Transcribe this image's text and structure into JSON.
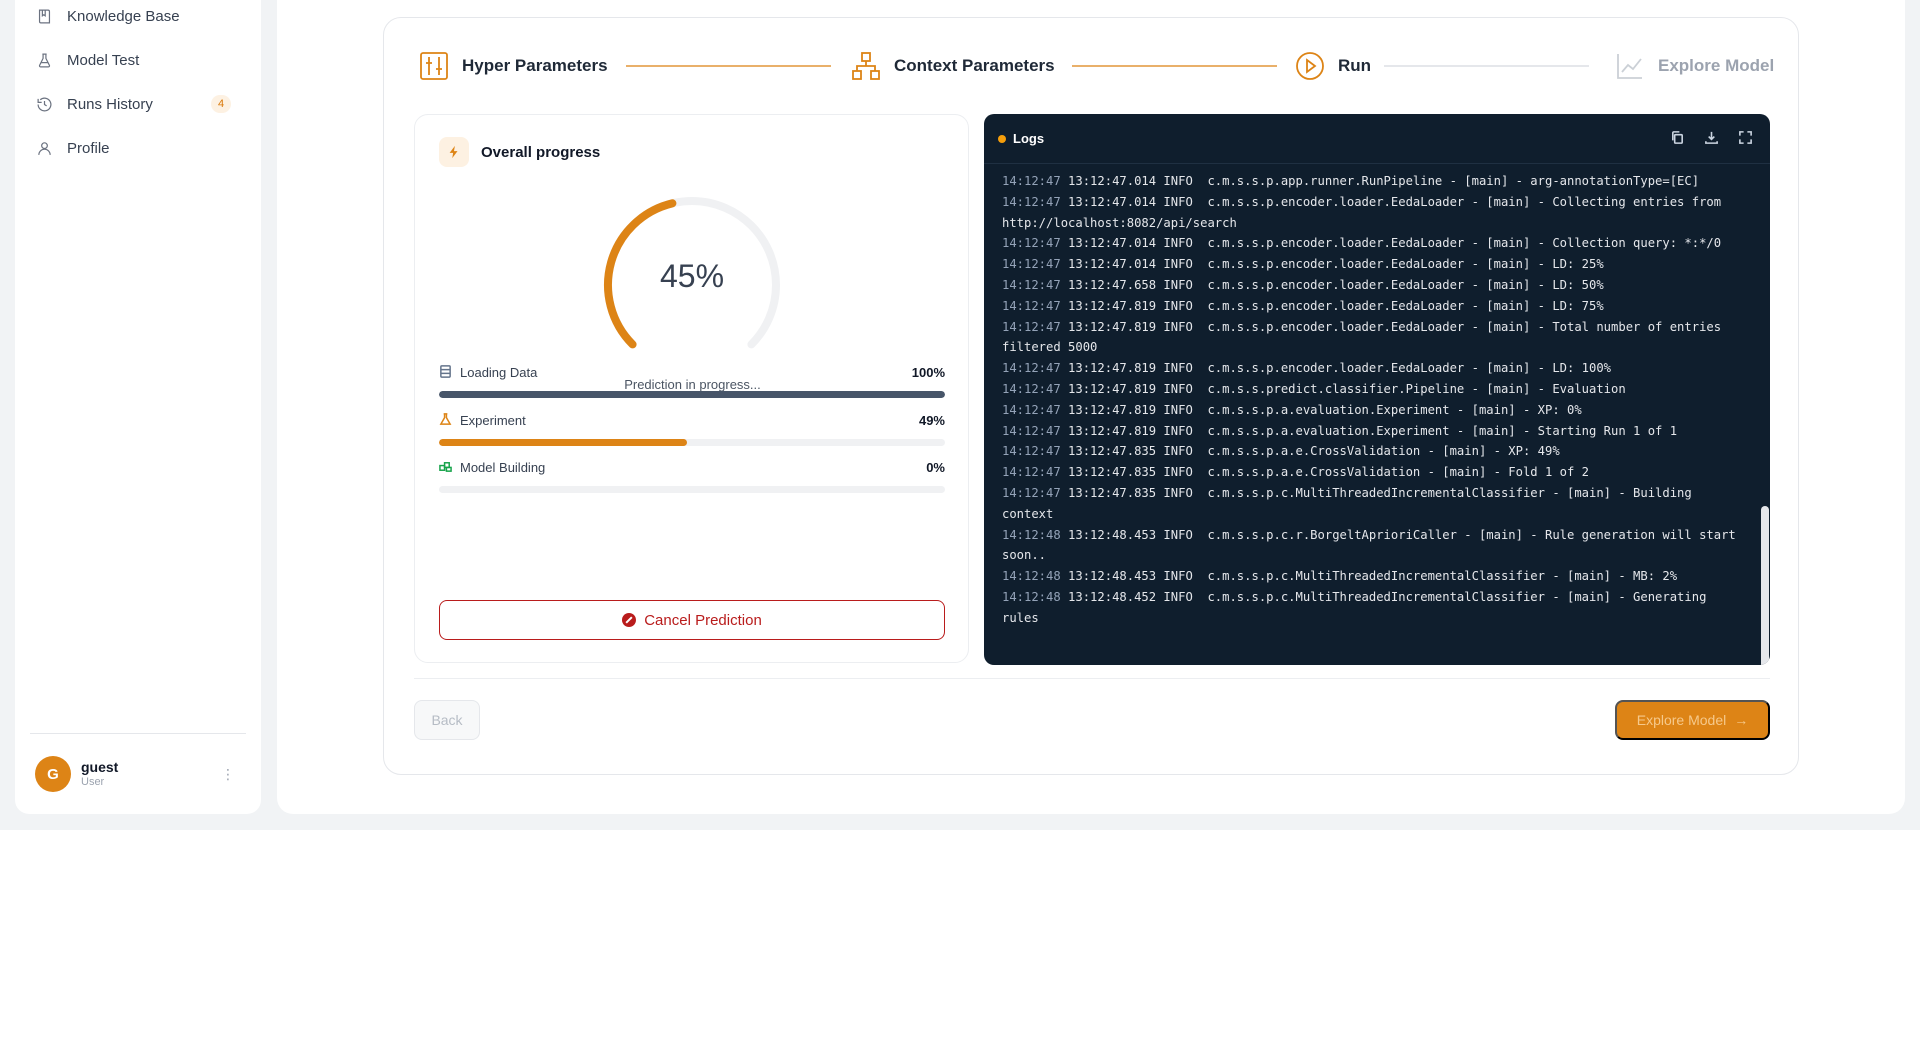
{
  "sidebar": {
    "items": [
      {
        "label": "Knowledge Base",
        "icon": "book-icon"
      },
      {
        "label": "Model Test",
        "icon": "flask-icon"
      },
      {
        "label": "Runs History",
        "icon": "history-icon",
        "badge": "4"
      },
      {
        "label": "Profile",
        "icon": "user-icon"
      }
    ],
    "user": {
      "initial": "G",
      "name": "guest",
      "role": "User"
    }
  },
  "stepper": {
    "steps": [
      {
        "label": "Hyper Parameters",
        "icon": "sliders-icon",
        "state": "done"
      },
      {
        "label": "Context Parameters",
        "icon": "hierarchy-icon",
        "state": "done"
      },
      {
        "label": "Run",
        "icon": "play-circle-icon",
        "state": "active"
      },
      {
        "label": "Explore Model",
        "icon": "line-chart-icon",
        "state": "disabled"
      }
    ]
  },
  "progress": {
    "title": "Overall progress",
    "percent": 45,
    "percent_label": "45%",
    "status": "Prediction in progress...",
    "tasks": [
      {
        "label": "Loading Data",
        "percent": 100,
        "percent_label": "100%",
        "color": "#475569"
      },
      {
        "label": "Experiment",
        "percent": 49,
        "percent_label": "49%",
        "color": "#dd8416"
      },
      {
        "label": "Model Building",
        "percent": 0,
        "percent_label": "0%",
        "color": "#16a34a"
      }
    ],
    "cancel_label": "Cancel Prediction"
  },
  "logs": {
    "title": "Logs",
    "lines": [
      {
        "ts": "14:12:47",
        "msg": "13:12:47.014 INFO  c.m.s.s.p.app.runner.RunPipeline - [main] - arg-annotationType=[EC]"
      },
      {
        "ts": "14:12:47",
        "msg": "13:12:47.014 INFO  c.m.s.s.p.encoder.loader.EedaLoader - [main] - Collecting entries from http://localhost:8082/api/search"
      },
      {
        "ts": "14:12:47",
        "msg": "13:12:47.014 INFO  c.m.s.s.p.encoder.loader.EedaLoader - [main] - Collection query: *:*/0"
      },
      {
        "ts": "14:12:47",
        "msg": "13:12:47.014 INFO  c.m.s.s.p.encoder.loader.EedaLoader - [main] - LD: 25%"
      },
      {
        "ts": "14:12:47",
        "msg": "13:12:47.658 INFO  c.m.s.s.p.encoder.loader.EedaLoader - [main] - LD: 50%"
      },
      {
        "ts": "14:12:47",
        "msg": "13:12:47.819 INFO  c.m.s.s.p.encoder.loader.EedaLoader - [main] - LD: 75%"
      },
      {
        "ts": "14:12:47",
        "msg": "13:12:47.819 INFO  c.m.s.s.p.encoder.loader.EedaLoader - [main] - Total number of entries filtered 5000"
      },
      {
        "ts": "14:12:47",
        "msg": "13:12:47.819 INFO  c.m.s.s.p.encoder.loader.EedaLoader - [main] - LD: 100%"
      },
      {
        "ts": "14:12:47",
        "msg": "13:12:47.819 INFO  c.m.s.s.predict.classifier.Pipeline - [main] - Evaluation"
      },
      {
        "ts": "14:12:47",
        "msg": "13:12:47.819 INFO  c.m.s.s.p.a.evaluation.Experiment - [main] - XP: 0%"
      },
      {
        "ts": "14:12:47",
        "msg": "13:12:47.819 INFO  c.m.s.s.p.a.evaluation.Experiment - [main] - Starting Run 1 of 1"
      },
      {
        "ts": "14:12:47",
        "msg": "13:12:47.835 INFO  c.m.s.s.p.a.e.CrossValidation - [main] - XP: 49%"
      },
      {
        "ts": "14:12:47",
        "msg": "13:12:47.835 INFO  c.m.s.s.p.a.e.CrossValidation - [main] - Fold 1 of 2"
      },
      {
        "ts": "14:12:47",
        "msg": "13:12:47.835 INFO  c.m.s.s.p.c.MultiThreadedIncrementalClassifier - [main] - Building context"
      },
      {
        "ts": "14:12:48",
        "msg": "13:12:48.453 INFO  c.m.s.s.p.c.r.BorgeltAprioriCaller - [main] - Rule generation will start soon.."
      },
      {
        "ts": "14:12:48",
        "msg": "13:12:48.453 INFO  c.m.s.s.p.c.MultiThreadedIncrementalClassifier - [main] - MB: 2%"
      },
      {
        "ts": "14:12:48",
        "msg": "13:12:48.452 INFO  c.m.s.s.p.c.MultiThreadedIncrementalClassifier - [main] - Generating rules"
      }
    ]
  },
  "footer": {
    "back_label": "Back",
    "explore_label": "Explore Model"
  },
  "colors": {
    "accent": "#dd8416",
    "danger": "#b91c1c",
    "logs_bg": "#0f1e2d"
  }
}
